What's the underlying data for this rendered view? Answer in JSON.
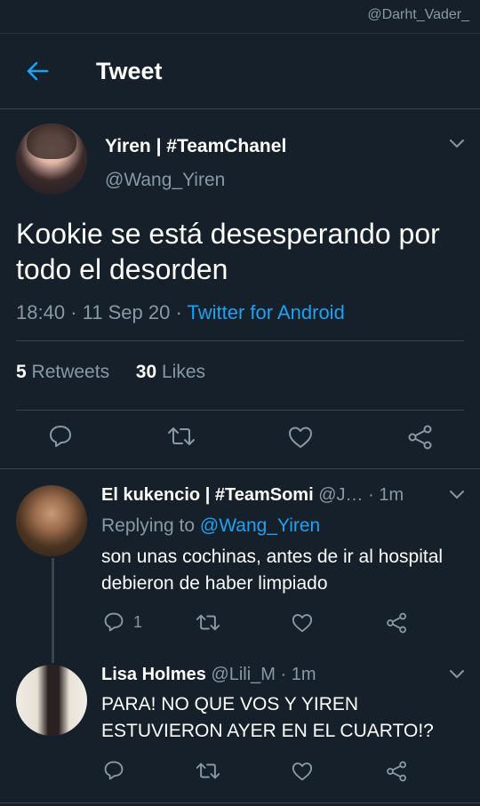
{
  "watermark": "@Darht_Vader_",
  "header": {
    "title": "Tweet"
  },
  "main_tweet": {
    "name": "Yiren | #TeamChanel",
    "handle": "@Wang_Yiren",
    "text": "Kookie se está desesperando por todo el desorden",
    "time": "18:40",
    "date": "11 Sep 20",
    "separator": "·",
    "source": "Twitter for Android",
    "retweets_count": "5",
    "retweets_label": "Retweets",
    "likes_count": "30",
    "likes_label": "Likes"
  },
  "replies": [
    {
      "name": "El kukencio | #TeamSomi",
      "handle": "@J…",
      "time": "1m",
      "replying_prefix": "Replying to",
      "replying_to": "@Wang_Yiren",
      "text": "son unas cochinas, antes de ir al hospital debieron de haber limpiado",
      "reply_count": "1"
    },
    {
      "name": "Lisa Holmes",
      "handle": "@Lili_M",
      "time": "1m",
      "text": "PARA! NO QUE VOS Y YIREN ESTUVIERON AYER EN EL CUARTO!?",
      "reply_count": ""
    }
  ],
  "colors": {
    "background": "#15202b",
    "accent": "#1da1f2",
    "muted": "#8899a6",
    "divider": "#38444d"
  },
  "icons": [
    "back-arrow-icon",
    "chevron-down-icon",
    "reply-icon",
    "retweet-icon",
    "like-icon",
    "share-icon"
  ]
}
